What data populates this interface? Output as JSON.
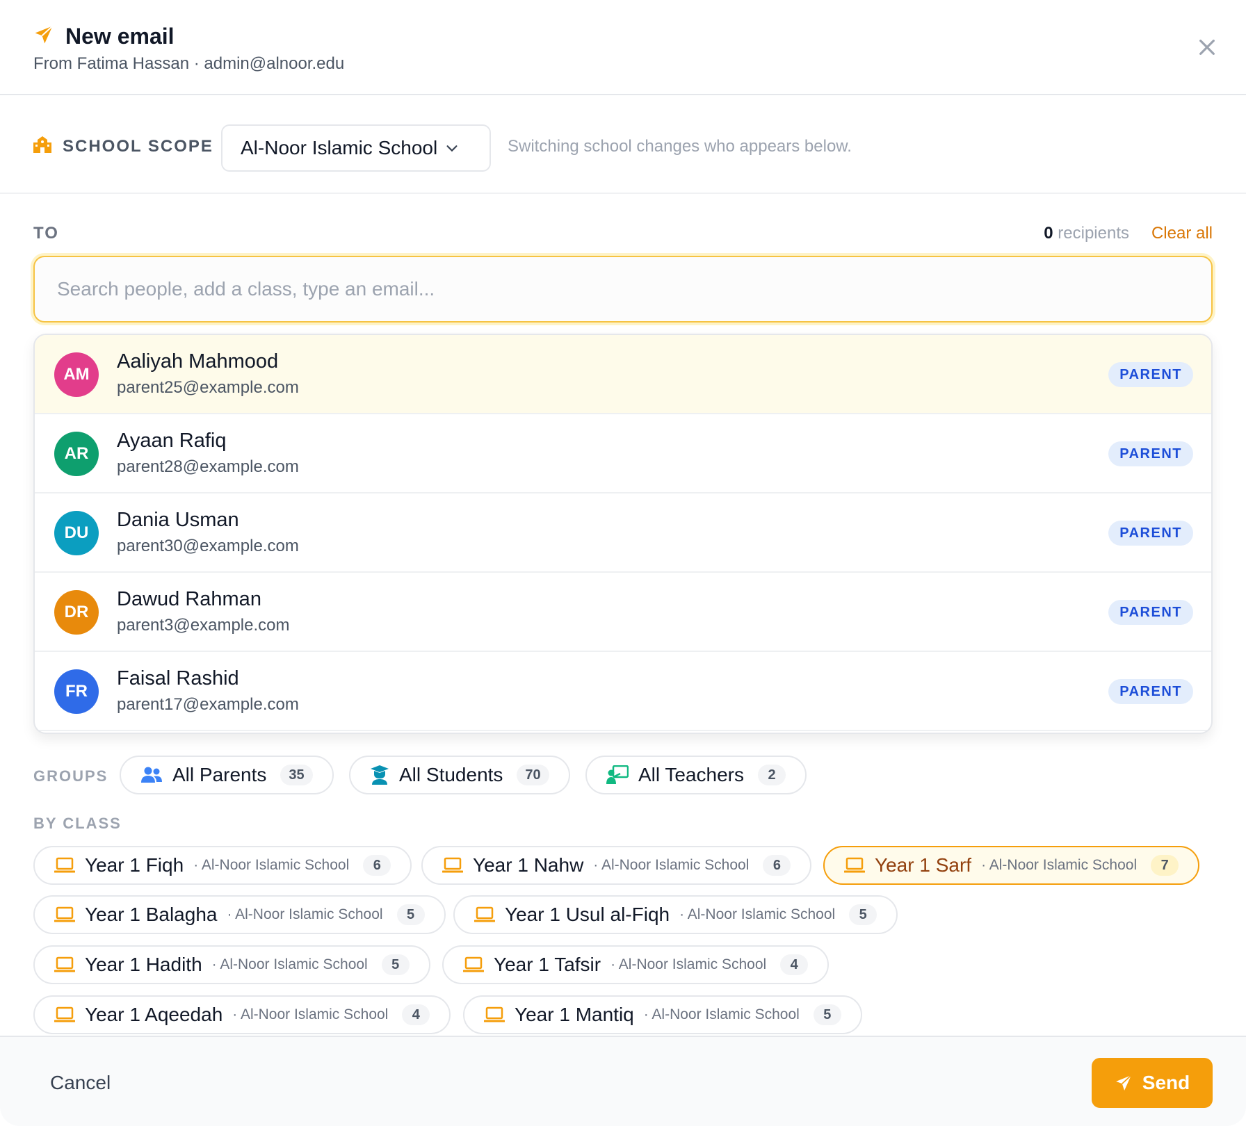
{
  "header": {
    "title": "New email",
    "from": "From Fatima Hassan · admin@alnoor.edu"
  },
  "scope": {
    "label": "SCHOOL SCOPE",
    "selected": "Al-Noor Islamic School",
    "hint": "Switching school changes who appears below."
  },
  "to": {
    "label": "TO",
    "count": "0",
    "count_suffix": "recipients",
    "clear_label": "Clear all",
    "search_placeholder": "Search people, add a class, type an email..."
  },
  "suggestions": [
    {
      "initials": "AM",
      "name": "Aaliyah Mahmood",
      "email": "parent25@example.com",
      "role": "PARENT",
      "color": "#e23d8b",
      "highlighted": true
    },
    {
      "initials": "AR",
      "name": "Ayaan Rafiq",
      "email": "parent28@example.com",
      "role": "PARENT",
      "color": "#0e9f6e"
    },
    {
      "initials": "DU",
      "name": "Dania Usman",
      "email": "parent30@example.com",
      "role": "PARENT",
      "color": "#0b9ec0"
    },
    {
      "initials": "DR",
      "name": "Dawud Rahman",
      "email": "parent3@example.com",
      "role": "PARENT",
      "color": "#e88a0c"
    },
    {
      "initials": "FR",
      "name": "Faisal Rashid",
      "email": "parent17@example.com",
      "role": "PARENT",
      "color": "#2f6be8"
    }
  ],
  "groups": {
    "label": "GROUPS",
    "items": [
      {
        "label": "All Parents",
        "count": "35",
        "icon": "users-icon"
      },
      {
        "label": "All Students",
        "count": "70",
        "icon": "graduate-icon"
      },
      {
        "label": "All Teachers",
        "count": "2",
        "icon": "teacher-icon"
      }
    ]
  },
  "classes": {
    "label": "BY CLASS",
    "items": [
      {
        "label": "Year 1 Fiqh",
        "school": "· Al-Noor Islamic School",
        "count": "6"
      },
      {
        "label": "Year 1 Nahw",
        "school": "· Al-Noor Islamic School",
        "count": "6"
      },
      {
        "label": "Year 1 Sarf",
        "school": "· Al-Noor Islamic School",
        "count": "7",
        "active": true
      },
      {
        "label": "Year 1 Balagha",
        "school": "· Al-Noor Islamic School",
        "count": "5"
      },
      {
        "label": "Year 1 Usul al-Fiqh",
        "school": "· Al-Noor Islamic School",
        "count": "5"
      },
      {
        "label": "Year 1 Hadith",
        "school": "· Al-Noor Islamic School",
        "count": "5"
      },
      {
        "label": "Year 1 Tafsir",
        "school": "· Al-Noor Islamic School",
        "count": "4"
      },
      {
        "label": "Year 1 Aqeedah",
        "school": "· Al-Noor Islamic School",
        "count": "4"
      },
      {
        "label": "Year 1 Mantiq",
        "school": "· Al-Noor Islamic School",
        "count": "5"
      }
    ]
  },
  "footer": {
    "cancel_label": "Cancel",
    "send_label": "Send"
  },
  "colors": {
    "accent": "#f59e0b",
    "badge_text": "#1d4ed8"
  }
}
